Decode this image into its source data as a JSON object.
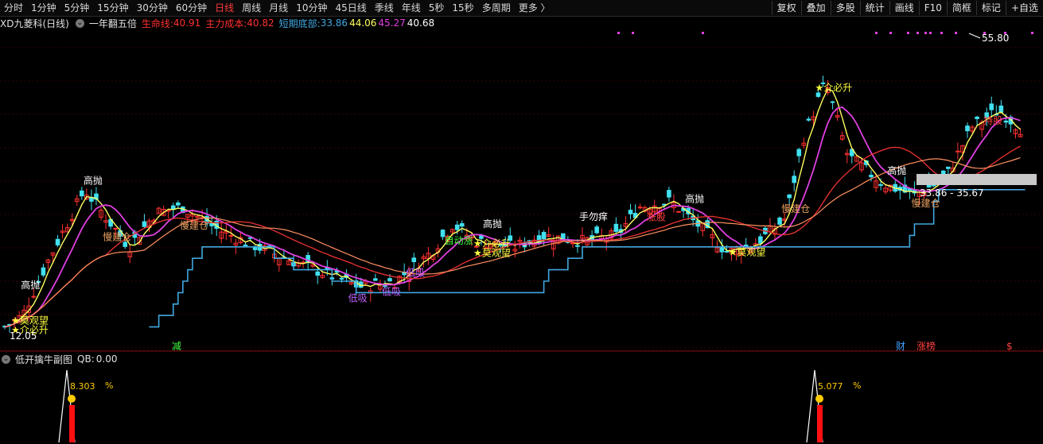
{
  "toolbar": {
    "periods": [
      "分时",
      "1分钟",
      "5分钟",
      "15分钟",
      "30分钟",
      "60分钟",
      "日线",
      "周线",
      "月线",
      "10分钟",
      "45日线",
      "季线",
      "年线",
      "5秒",
      "15秒",
      "多周期",
      "更多 〉"
    ],
    "active_period": "日线",
    "tools": [
      "复权",
      "叠加",
      "多股",
      "统计",
      "画线",
      "F10",
      "简框",
      "标记",
      "+自选"
    ]
  },
  "main_info": {
    "stock_name": "XD九菱科(日线)",
    "indicator_name": "一年翻五倍",
    "lifeline_label": "生命线:",
    "lifeline_value": "40.91",
    "maincost_label": "主力成本:",
    "maincost_value": "40.82",
    "shortbottom_label": "短期底部:",
    "shortbottom_value": "33.86",
    "v1": "44.06",
    "v2": "45.27",
    "v3": "40.68"
  },
  "price_labels": {
    "high": "55.80",
    "low": "12.05",
    "range": "33.86 - 35.67"
  },
  "signals": [
    {
      "text": "高抛",
      "color": "#ffffff",
      "idx": 5
    },
    {
      "text": "高抛",
      "color": "#ffffff",
      "idx": 18
    },
    {
      "text": "慢建仓",
      "color": "#e8a060",
      "idx": 22
    },
    {
      "text": "慢建仓",
      "color": "#e8a060",
      "idx": 38
    },
    {
      "text": "低吸",
      "color": "#c060ff",
      "idx": 73
    },
    {
      "text": "低吸",
      "color": "#c060ff",
      "idx": 80
    },
    {
      "text": "低吸",
      "color": "#c060ff",
      "idx": 85
    },
    {
      "text": "自动涨",
      "color": "#40ff40",
      "idx": 93
    },
    {
      "text": "高抛",
      "color": "#ffffff",
      "idx": 101
    },
    {
      "text": "★莫观望",
      "color": "#ffff40",
      "idx": 99
    },
    {
      "text": "★介必升",
      "color": "#ffff40",
      "idx": 99
    },
    {
      "text": "手勿痒",
      "color": "#ffffff",
      "idx": 121
    },
    {
      "text": "涨股",
      "color": "#ff4040",
      "idx": 135
    },
    {
      "text": "高抛",
      "color": "#ffffff",
      "idx": 143
    },
    {
      "text": "★莫观望",
      "color": "#ffff40",
      "idx": 152
    },
    {
      "text": "慢建仓",
      "color": "#e8a060",
      "idx": 163
    },
    {
      "text": "★介必升",
      "color": "#ffff40",
      "idx": 170
    },
    {
      "text": "高抛",
      "color": "#ffffff",
      "idx": 185
    },
    {
      "text": "慢建仓",
      "color": "#e8a060",
      "idx": 190
    },
    {
      "text": "持股",
      "color": "#ff4040",
      "idx": 205
    },
    {
      "text": "★莫观望",
      "color": "#ffff40",
      "idx": 3
    },
    {
      "text": "★介必升",
      "color": "#ffff40",
      "idx": 3
    }
  ],
  "bottom_marks": [
    {
      "text": "减",
      "color": "#40ff40"
    },
    {
      "text": "财",
      "color": "#40a0ff"
    },
    {
      "text": "涨榜",
      "color": "#ff4040"
    },
    {
      "text": "$",
      "color": "#ff4040"
    }
  ],
  "sub_info": {
    "name": "低开擒牛副图",
    "qb_label": "QB:",
    "qb_value": "0.00"
  },
  "sub_values": [
    {
      "text": "8.303",
      "unit": "%"
    },
    {
      "text": "5.077",
      "unit": "%"
    }
  ],
  "colors": {
    "up": "#ff3030",
    "down": "#40e0f0",
    "lifeline": "#e03030",
    "maincost": "#ff9060",
    "bottomline": "#40a8e0",
    "ma_yellow": "#ffff60",
    "ma_magenta": "#e040e0"
  }
}
